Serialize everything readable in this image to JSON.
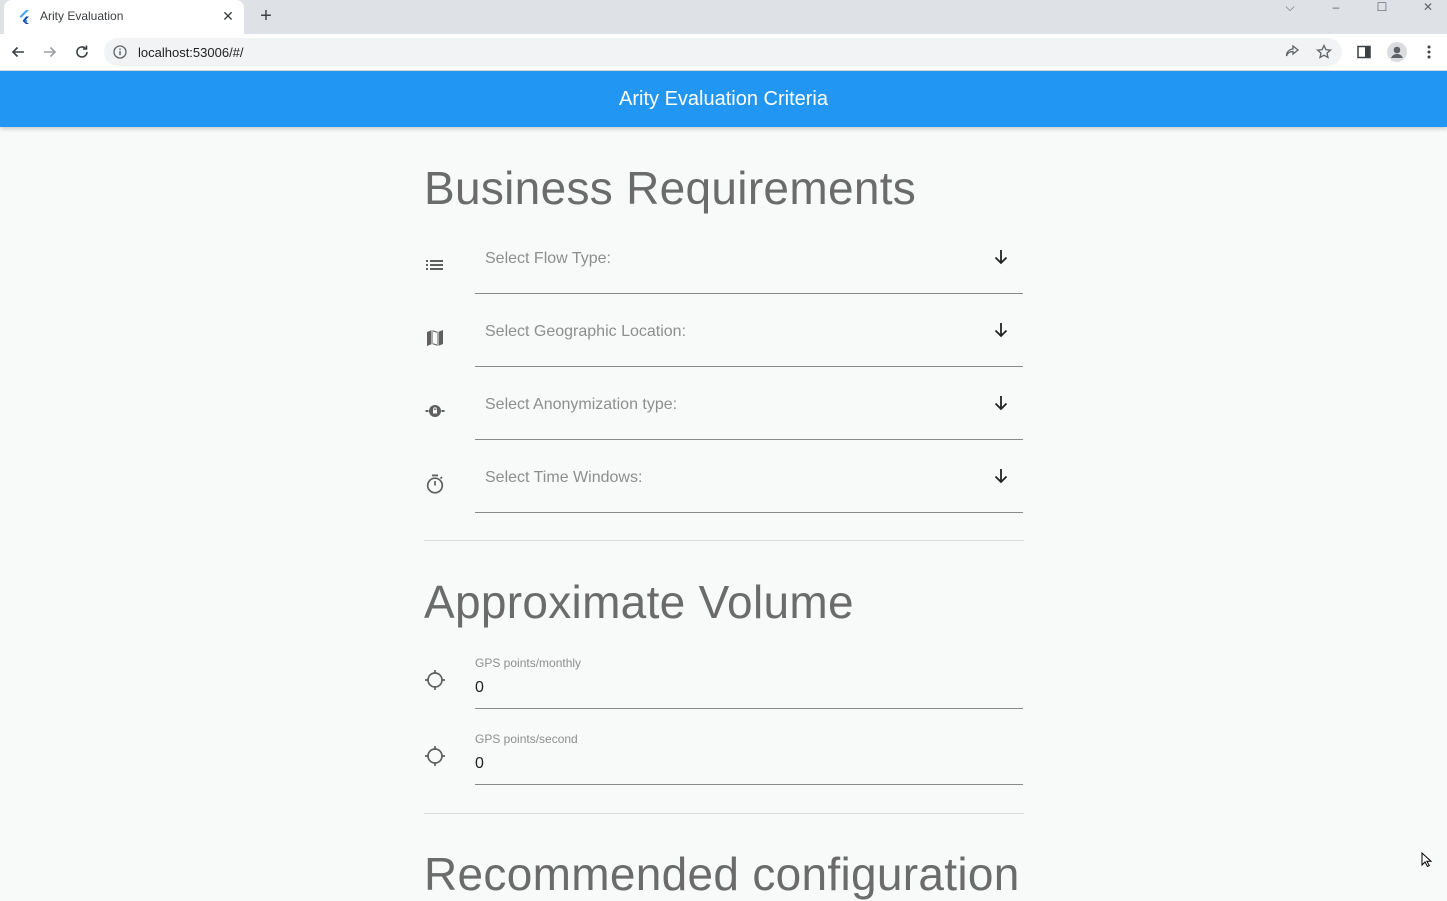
{
  "browser": {
    "tab_title": "Arity Evaluation",
    "tab_close": "✕",
    "new_tab": "+",
    "url": "localhost:53006/#/",
    "window_controls": {
      "dropdown": "⌵",
      "minimize": "–",
      "maximize": "☐",
      "close": "✕"
    }
  },
  "app": {
    "title": "Arity Evaluation Criteria"
  },
  "business": {
    "title": "Business Requirements",
    "fields": [
      {
        "label": "Select Flow Type:",
        "icon": "list-icon"
      },
      {
        "label": "Select Geographic Location:",
        "icon": "map-icon"
      },
      {
        "label": "Select Anonymization type:",
        "icon": "anonymization-icon"
      },
      {
        "label": "Select Time Windows:",
        "icon": "timer-icon"
      }
    ]
  },
  "volume": {
    "title": "Approximate Volume",
    "fields": [
      {
        "label": "GPS points/monthly",
        "value": "0",
        "icon": "gps-icon"
      },
      {
        "label": "GPS points/second",
        "value": "0",
        "icon": "gps-icon"
      }
    ]
  },
  "next_section": {
    "title": "Recommended configuration"
  },
  "colors": {
    "appbar": "#2196f3",
    "background": "#f8f9f9",
    "title_text": "#6b6b6b"
  }
}
